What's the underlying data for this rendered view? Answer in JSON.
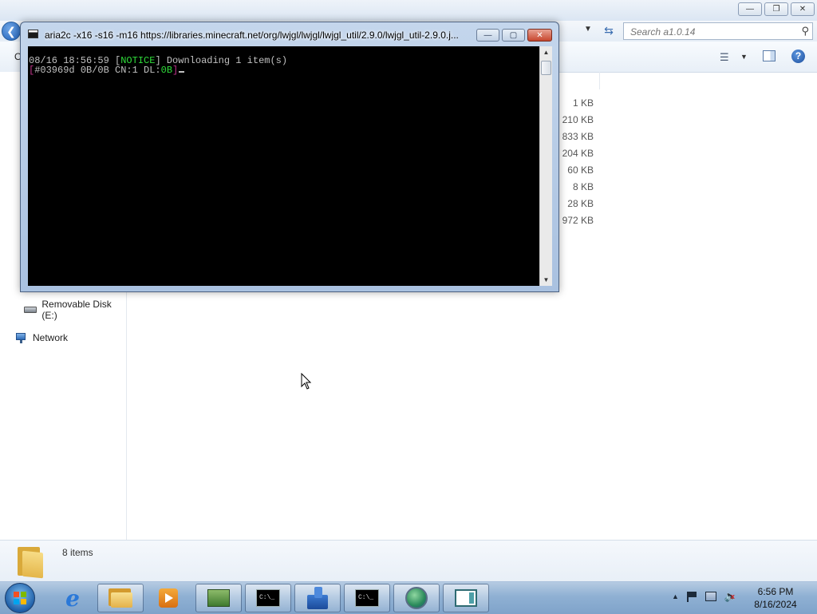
{
  "explorer": {
    "search_placeholder": "Search a1.0.14",
    "toolbar_partial_label": "O",
    "file_sizes": [
      "1 KB",
      "210 KB",
      "833 KB",
      "204 KB",
      "60 KB",
      "8 KB",
      "28 KB",
      "972 KB"
    ],
    "nav": {
      "removable_disk_label": "Removable Disk (E:)",
      "network_label": "Network"
    },
    "details": {
      "items_count": "8 items"
    }
  },
  "console": {
    "title": "aria2c  -x16 -s16 -m16 https://libraries.minecraft.net/org/lwjgl/lwjgl/lwjgl_util/2.9.0/lwjgl_util-2.9.0.j...",
    "line1": {
      "timestamp": "08/16 18:56:59 ",
      "open_bracket": "[",
      "notice": "NOTICE",
      "rest": "] Downloading 1 item(s)"
    },
    "line2": {
      "open": "[",
      "progress": "#03969d 0B/0B CN:1 DL:",
      "speed": "0B",
      "close": "]"
    }
  },
  "taskbar": {
    "icons": [
      "start-orb-icon",
      "internet-explorer-icon",
      "file-explorer-icon",
      "media-player-icon",
      "circuit-board-icon",
      "command-prompt-icon",
      "stack-app-icon",
      "command-prompt-icon",
      "globe-browser-icon",
      "window-app-icon"
    ],
    "clock_time": "6:56 PM",
    "clock_date": "8/16/2024"
  },
  "colors": {
    "console_bg": "#000000",
    "console_text": "#c0c0c0",
    "notice_green": "#2fdc3a",
    "bracket_magenta": "#c0338a",
    "close_button_red": "#c7462e",
    "taskbar_blue": "#8fb0d3"
  }
}
